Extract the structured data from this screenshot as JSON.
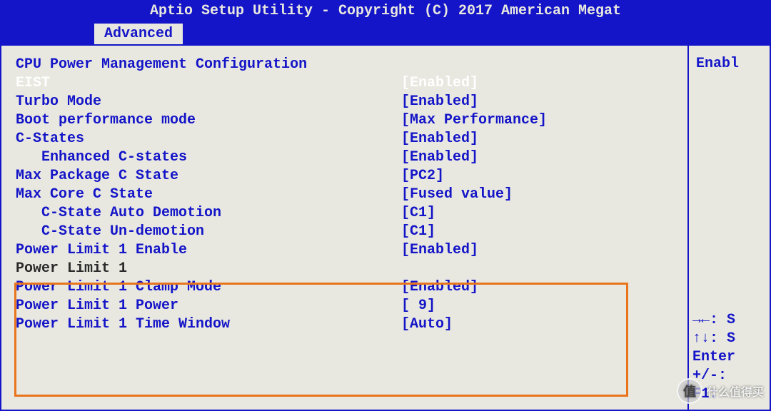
{
  "header": {
    "title": "Aptio Setup Utility - Copyright (C) 2017 American Megat"
  },
  "tab": {
    "label": "Advanced"
  },
  "section": {
    "title": "CPU Power Management Configuration"
  },
  "settings": [
    {
      "label": "EIST",
      "value": "[Enabled]",
      "selected": true,
      "indent": false,
      "black": false
    },
    {
      "label": "Turbo Mode",
      "value": "[Enabled]",
      "selected": false,
      "indent": false,
      "black": false
    },
    {
      "label": "Boot performance mode",
      "value": "[Max Performance]",
      "selected": false,
      "indent": false,
      "black": false
    },
    {
      "label": "C-States",
      "value": "[Enabled]",
      "selected": false,
      "indent": false,
      "black": false
    },
    {
      "label": "Enhanced C-states",
      "value": "[Enabled]",
      "selected": false,
      "indent": true,
      "black": false
    },
    {
      "label": "Max Package C State",
      "value": "[PC2]",
      "selected": false,
      "indent": false,
      "black": false
    },
    {
      "label": "Max Core C State",
      "value": "[Fused value]",
      "selected": false,
      "indent": false,
      "black": false
    },
    {
      "label": "C-State Auto Demotion",
      "value": "[C1]",
      "selected": false,
      "indent": true,
      "black": false
    },
    {
      "label": "C-State Un-demotion",
      "value": "[C1]",
      "selected": false,
      "indent": true,
      "black": false
    },
    {
      "label": "Power Limit 1 Enable",
      "value": "[Enabled]",
      "selected": false,
      "indent": false,
      "black": false
    },
    {
      "label": "Power Limit 1",
      "value": "",
      "selected": false,
      "indent": false,
      "black": true
    },
    {
      "label": "Power Limit 1 Clamp Mode",
      "value": "[Enabled]",
      "selected": false,
      "indent": false,
      "black": false
    },
    {
      "label": "Power Limit 1 Power",
      "value": "[ 9]",
      "selected": false,
      "indent": false,
      "black": false
    },
    {
      "label": "Power Limit 1 Time Window",
      "value": "[Auto]",
      "selected": false,
      "indent": false,
      "black": false
    }
  ],
  "help": {
    "text": "Enabl"
  },
  "keys": {
    "k1": "→←: S",
    "k2": "↑↓: S",
    "k3": "Enter",
    "k4": "+/-:",
    "k5": "F1: "
  },
  "watermark": {
    "icon": "值",
    "text": "什么值得买"
  }
}
